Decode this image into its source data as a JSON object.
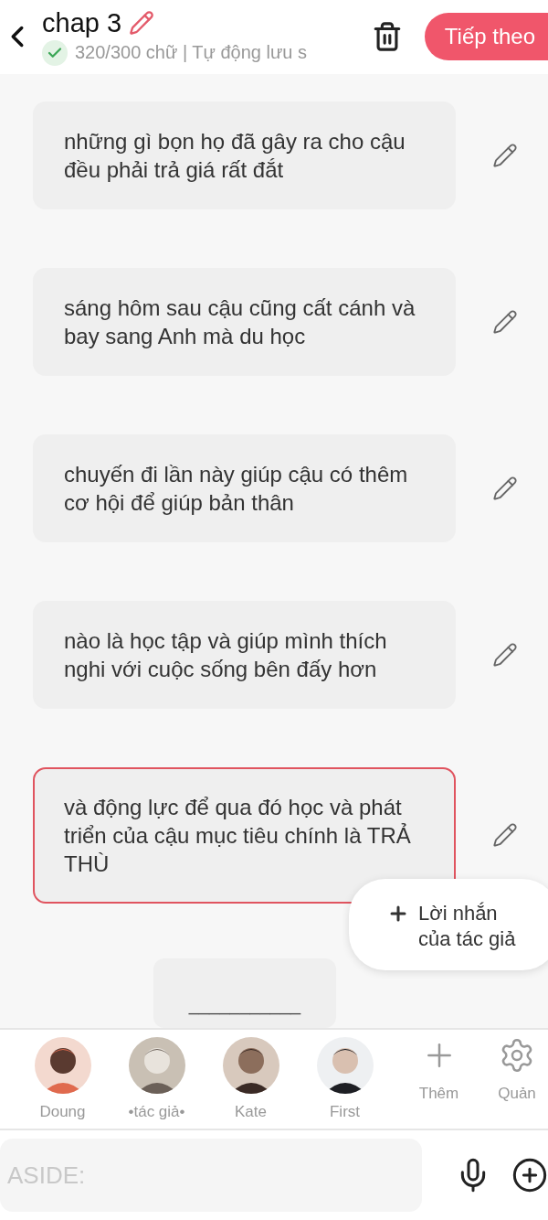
{
  "header": {
    "title": "chap 3",
    "status": "320/300 chữ | Tự động lưu s",
    "saved": true,
    "next_button": "Tiếp theo"
  },
  "messages": [
    {
      "text": "những gì bọn họ đã gây ra cho cậu đều phải trả giá rất đắt",
      "selected": false
    },
    {
      "text": "sáng hôm sau cậu cũng cất cánh và bay sang Anh mà du học",
      "selected": false
    },
    {
      "text": "chuyến đi lần này giúp cậu có thêm cơ hội để giúp bản thân",
      "selected": false
    },
    {
      "text": "nào là học tập và giúp mình thích nghi với cuộc sống bên đấy hơn",
      "selected": false
    },
    {
      "text": "và động lực để qua đó học và phát triển của cậu mục tiêu chính là TRẢ THÙ",
      "selected": true
    }
  ],
  "separator": "___________",
  "author_note_button": "Lời nhắn\ncủa tác giả",
  "characters": [
    {
      "name": "Doung",
      "kind": "picture"
    },
    {
      "name": "•tác giả•",
      "kind": "picture"
    },
    {
      "name": "Kate",
      "kind": "picture"
    },
    {
      "name": "First",
      "kind": "picture"
    }
  ],
  "actions": [
    {
      "kind": "add",
      "label": "Thêm"
    },
    {
      "kind": "manage",
      "label": "Quản"
    }
  ],
  "input": {
    "placeholder": "ASIDE:"
  }
}
